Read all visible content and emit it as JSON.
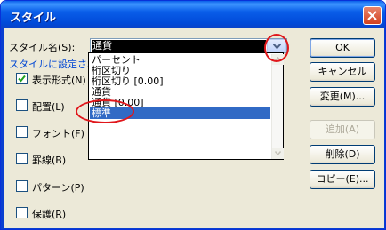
{
  "window": {
    "title": "スタイル"
  },
  "style_name": {
    "label": "スタイル名(S):",
    "value": "通貨"
  },
  "settings_label": "スタイルに設定され",
  "dropdown_items": [
    {
      "label": "パーセント",
      "selected": false
    },
    {
      "label": "桁区切り",
      "selected": false
    },
    {
      "label": "桁区切り [0.00]",
      "selected": false
    },
    {
      "label": "通貨",
      "selected": false
    },
    {
      "label": "通貨 [0.00]",
      "selected": false
    },
    {
      "label": "標準",
      "selected": true
    }
  ],
  "checkboxes": [
    {
      "label": "表示形式(N)",
      "checked": true
    },
    {
      "label": "配置(L)",
      "checked": false
    },
    {
      "label": "フォント(F)",
      "checked": false
    },
    {
      "label": "罫線(B)",
      "checked": false
    },
    {
      "label": "パターン(P)",
      "checked": false
    },
    {
      "label": "保護(R)",
      "checked": false
    }
  ],
  "buttons": {
    "ok": "OK",
    "cancel": "キャンセル",
    "modify": "変更(M)...",
    "add": "追加(A)",
    "delete": "削除(D)",
    "copy": "コピー(E)..."
  },
  "colors": {
    "title_bar": "#0a5ee9",
    "selection": "#316ac5",
    "annotation": "#e0161b"
  }
}
